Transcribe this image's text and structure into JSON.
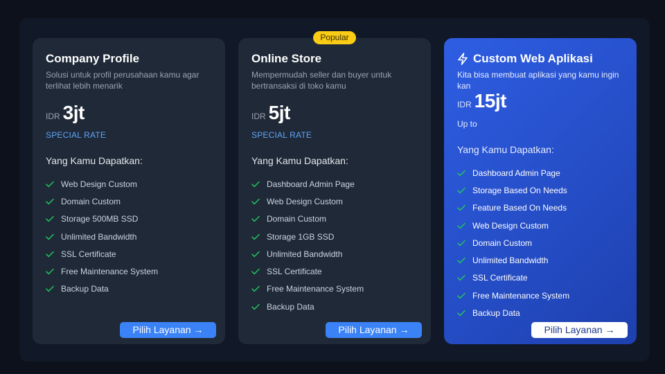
{
  "badge": "Popular",
  "colors": {
    "check": "#22c55e",
    "accent": "#3b82f6",
    "badge": "#facc15",
    "highlight_card": "#2e5ee3"
  },
  "cards": [
    {
      "title": "Company Profile",
      "description": "Solusi untuk profil perusahaan kamu agar terlihat lebih menarik",
      "currency": "IDR",
      "price": "3jt",
      "rate_note": "SPECIAL RATE",
      "features_heading": "Yang Kamu Dapatkan:",
      "features": [
        "Web Design Custom",
        "Domain Custom",
        "Storage 500MB SSD",
        "Unlimited Bandwidth",
        "SSL Certificate",
        "Free Maintenance System",
        "Backup Data"
      ],
      "button": "Pilih Layanan →"
    },
    {
      "title": "Online Store",
      "description": "Mempermudah seller dan buyer untuk bertransaksi di toko kamu",
      "currency": "IDR",
      "price": "5jt",
      "rate_note": "SPECIAL RATE",
      "features_heading": "Yang Kamu Dapatkan:",
      "features": [
        "Dashboard Admin Page",
        "Web Design Custom",
        "Domain Custom",
        "Storage 1GB SSD",
        "Unlimited Bandwidth",
        "SSL Certificate",
        "Free Maintenance System",
        "Backup Data"
      ],
      "button": "Pilih Layanan →"
    },
    {
      "title": "Custom Web Aplikasi",
      "icon": "lightning-icon",
      "description": "Kita bisa membuat aplikasi yang kamu ingin kan",
      "currency": "IDR",
      "price": "15jt",
      "rate_note": "Up to",
      "features_heading": "Yang Kamu Dapatkan:",
      "features": [
        "Dashboard Admin Page",
        "Storage Based On Needs",
        "Feature Based On Needs",
        "Web Design Custom",
        "Domain Custom",
        "Unlimited Bandwidth",
        "SSL Certificate",
        "Free Maintenance System",
        "Backup Data"
      ],
      "button": "Pilih Layanan →"
    }
  ]
}
